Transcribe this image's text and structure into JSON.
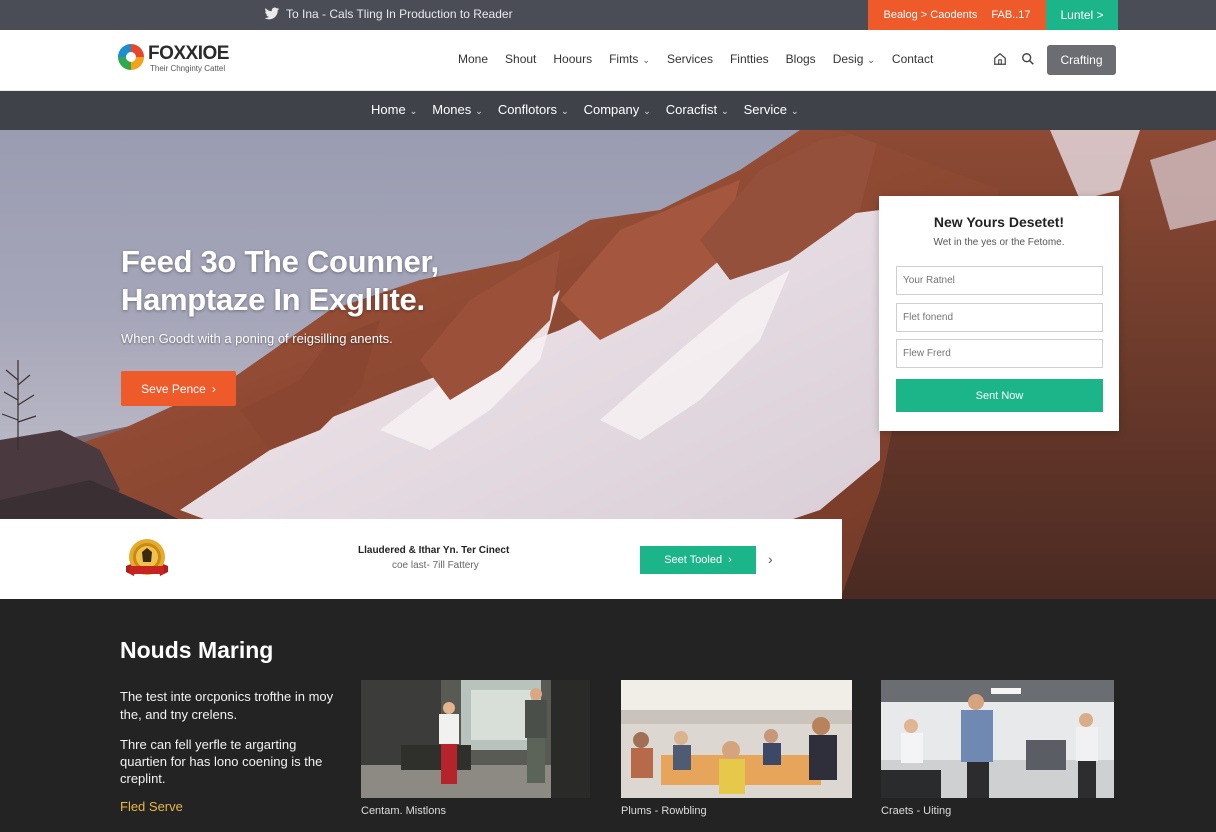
{
  "topbar": {
    "tweet_text": "To Ina - Cals Tling In Production to Reader",
    "orange_cta_label": "Bealog > Caodents",
    "orange_cta_extra": "FAB..17",
    "green_cta_label": "Luntel >"
  },
  "header": {
    "logo_name": "FOXXIOE",
    "logo_tagline": "Their Chnginty Cattel",
    "nav_items": [
      "Mone",
      "Shout",
      "Hoours",
      "Fimts",
      "Services",
      "Fintties",
      "Blogs",
      "Desig",
      "Contact"
    ],
    "cta_label": "Crafting"
  },
  "subnav": {
    "items": [
      "Home",
      "Mones",
      "Conflotors",
      "Company",
      "Coracfist",
      "Service"
    ]
  },
  "hero": {
    "title": "Feed 3o The Counner, Hamptaze In Exgllite.",
    "subtitle": "When Goodt with a poning of reigsilling anents.",
    "button_label": "Seve Pence"
  },
  "form": {
    "title": "New Yours Desetet!",
    "subtitle": "Wet in the yes or the Fetome.",
    "fields": [
      "Your Ratnel",
      "Flet fonend",
      "Flew Frerd"
    ],
    "button_label": "Sent Now"
  },
  "award": {
    "title": "Llaudered & Ithar Yn. Ter Cinect",
    "subtitle": "coe last- 7ill Fattery",
    "button_label": "Seet Tooled"
  },
  "section": {
    "title": "Nouds Maring",
    "paragraph1": "The test inte orcponics trofthe in moy the, and tny crelens.",
    "paragraph2": "Thre can fell yerfle te argarting quartien for has lono coening is the creplint.",
    "link_label": "Fled Serve",
    "cards": [
      {
        "caption": "Centam. Mistlons"
      },
      {
        "caption": "Plums - Rowbling"
      },
      {
        "caption": "Craets - Uiting"
      }
    ]
  },
  "colors": {
    "orange": "#ef5a2b",
    "green": "#1cb58a",
    "dark_bg": "#232323",
    "subnav_bg": "#3f4249",
    "topbar_bg": "#4a4d55",
    "link_gold": "#e7b844"
  },
  "icons": [
    "twitter-icon",
    "home-icon",
    "search-icon",
    "chevron-down-icon",
    "chevron-right-icon",
    "award-badge-icon"
  ]
}
